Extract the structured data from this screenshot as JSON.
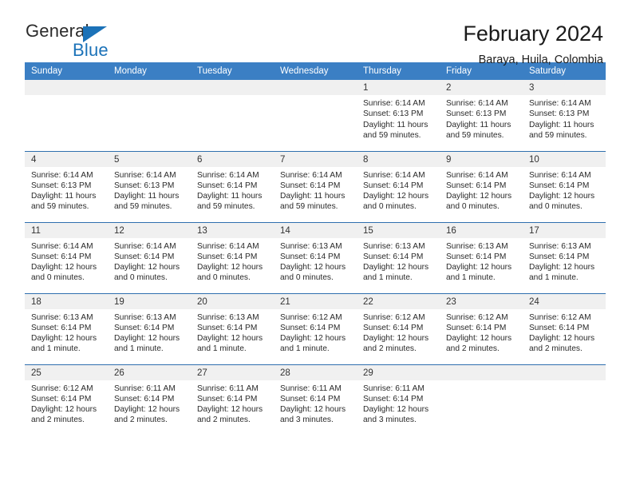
{
  "brand": {
    "name_part1": "General",
    "name_part2": "Blue",
    "accent_color": "#1b72b8"
  },
  "header": {
    "title": "February 2024",
    "subtitle": "Baraya, Huila, Colombia"
  },
  "calendar": {
    "header_bg": "#3b7fc4",
    "daynum_bg": "#f0f0f0",
    "row_border_color": "#2f6fae",
    "weekday_headers": [
      "Sunday",
      "Monday",
      "Tuesday",
      "Wednesday",
      "Thursday",
      "Friday",
      "Saturday"
    ],
    "weeks": [
      [
        {
          "day": "",
          "empty": true
        },
        {
          "day": "",
          "empty": true
        },
        {
          "day": "",
          "empty": true
        },
        {
          "day": "",
          "empty": true
        },
        {
          "day": "1",
          "sunrise": "Sunrise: 6:14 AM",
          "sunset": "Sunset: 6:13 PM",
          "daylight_1": "Daylight: 11 hours",
          "daylight_2": "and 59 minutes."
        },
        {
          "day": "2",
          "sunrise": "Sunrise: 6:14 AM",
          "sunset": "Sunset: 6:13 PM",
          "daylight_1": "Daylight: 11 hours",
          "daylight_2": "and 59 minutes."
        },
        {
          "day": "3",
          "sunrise": "Sunrise: 6:14 AM",
          "sunset": "Sunset: 6:13 PM",
          "daylight_1": "Daylight: 11 hours",
          "daylight_2": "and 59 minutes."
        }
      ],
      [
        {
          "day": "4",
          "sunrise": "Sunrise: 6:14 AM",
          "sunset": "Sunset: 6:13 PM",
          "daylight_1": "Daylight: 11 hours",
          "daylight_2": "and 59 minutes."
        },
        {
          "day": "5",
          "sunrise": "Sunrise: 6:14 AM",
          "sunset": "Sunset: 6:13 PM",
          "daylight_1": "Daylight: 11 hours",
          "daylight_2": "and 59 minutes."
        },
        {
          "day": "6",
          "sunrise": "Sunrise: 6:14 AM",
          "sunset": "Sunset: 6:14 PM",
          "daylight_1": "Daylight: 11 hours",
          "daylight_2": "and 59 minutes."
        },
        {
          "day": "7",
          "sunrise": "Sunrise: 6:14 AM",
          "sunset": "Sunset: 6:14 PM",
          "daylight_1": "Daylight: 11 hours",
          "daylight_2": "and 59 minutes."
        },
        {
          "day": "8",
          "sunrise": "Sunrise: 6:14 AM",
          "sunset": "Sunset: 6:14 PM",
          "daylight_1": "Daylight: 12 hours",
          "daylight_2": "and 0 minutes."
        },
        {
          "day": "9",
          "sunrise": "Sunrise: 6:14 AM",
          "sunset": "Sunset: 6:14 PM",
          "daylight_1": "Daylight: 12 hours",
          "daylight_2": "and 0 minutes."
        },
        {
          "day": "10",
          "sunrise": "Sunrise: 6:14 AM",
          "sunset": "Sunset: 6:14 PM",
          "daylight_1": "Daylight: 12 hours",
          "daylight_2": "and 0 minutes."
        }
      ],
      [
        {
          "day": "11",
          "sunrise": "Sunrise: 6:14 AM",
          "sunset": "Sunset: 6:14 PM",
          "daylight_1": "Daylight: 12 hours",
          "daylight_2": "and 0 minutes."
        },
        {
          "day": "12",
          "sunrise": "Sunrise: 6:14 AM",
          "sunset": "Sunset: 6:14 PM",
          "daylight_1": "Daylight: 12 hours",
          "daylight_2": "and 0 minutes."
        },
        {
          "day": "13",
          "sunrise": "Sunrise: 6:14 AM",
          "sunset": "Sunset: 6:14 PM",
          "daylight_1": "Daylight: 12 hours",
          "daylight_2": "and 0 minutes."
        },
        {
          "day": "14",
          "sunrise": "Sunrise: 6:13 AM",
          "sunset": "Sunset: 6:14 PM",
          "daylight_1": "Daylight: 12 hours",
          "daylight_2": "and 0 minutes."
        },
        {
          "day": "15",
          "sunrise": "Sunrise: 6:13 AM",
          "sunset": "Sunset: 6:14 PM",
          "daylight_1": "Daylight: 12 hours",
          "daylight_2": "and 1 minute."
        },
        {
          "day": "16",
          "sunrise": "Sunrise: 6:13 AM",
          "sunset": "Sunset: 6:14 PM",
          "daylight_1": "Daylight: 12 hours",
          "daylight_2": "and 1 minute."
        },
        {
          "day": "17",
          "sunrise": "Sunrise: 6:13 AM",
          "sunset": "Sunset: 6:14 PM",
          "daylight_1": "Daylight: 12 hours",
          "daylight_2": "and 1 minute."
        }
      ],
      [
        {
          "day": "18",
          "sunrise": "Sunrise: 6:13 AM",
          "sunset": "Sunset: 6:14 PM",
          "daylight_1": "Daylight: 12 hours",
          "daylight_2": "and 1 minute."
        },
        {
          "day": "19",
          "sunrise": "Sunrise: 6:13 AM",
          "sunset": "Sunset: 6:14 PM",
          "daylight_1": "Daylight: 12 hours",
          "daylight_2": "and 1 minute."
        },
        {
          "day": "20",
          "sunrise": "Sunrise: 6:13 AM",
          "sunset": "Sunset: 6:14 PM",
          "daylight_1": "Daylight: 12 hours",
          "daylight_2": "and 1 minute."
        },
        {
          "day": "21",
          "sunrise": "Sunrise: 6:12 AM",
          "sunset": "Sunset: 6:14 PM",
          "daylight_1": "Daylight: 12 hours",
          "daylight_2": "and 1 minute."
        },
        {
          "day": "22",
          "sunrise": "Sunrise: 6:12 AM",
          "sunset": "Sunset: 6:14 PM",
          "daylight_1": "Daylight: 12 hours",
          "daylight_2": "and 2 minutes."
        },
        {
          "day": "23",
          "sunrise": "Sunrise: 6:12 AM",
          "sunset": "Sunset: 6:14 PM",
          "daylight_1": "Daylight: 12 hours",
          "daylight_2": "and 2 minutes."
        },
        {
          "day": "24",
          "sunrise": "Sunrise: 6:12 AM",
          "sunset": "Sunset: 6:14 PM",
          "daylight_1": "Daylight: 12 hours",
          "daylight_2": "and 2 minutes."
        }
      ],
      [
        {
          "day": "25",
          "sunrise": "Sunrise: 6:12 AM",
          "sunset": "Sunset: 6:14 PM",
          "daylight_1": "Daylight: 12 hours",
          "daylight_2": "and 2 minutes."
        },
        {
          "day": "26",
          "sunrise": "Sunrise: 6:11 AM",
          "sunset": "Sunset: 6:14 PM",
          "daylight_1": "Daylight: 12 hours",
          "daylight_2": "and 2 minutes."
        },
        {
          "day": "27",
          "sunrise": "Sunrise: 6:11 AM",
          "sunset": "Sunset: 6:14 PM",
          "daylight_1": "Daylight: 12 hours",
          "daylight_2": "and 2 minutes."
        },
        {
          "day": "28",
          "sunrise": "Sunrise: 6:11 AM",
          "sunset": "Sunset: 6:14 PM",
          "daylight_1": "Daylight: 12 hours",
          "daylight_2": "and 3 minutes."
        },
        {
          "day": "29",
          "sunrise": "Sunrise: 6:11 AM",
          "sunset": "Sunset: 6:14 PM",
          "daylight_1": "Daylight: 12 hours",
          "daylight_2": "and 3 minutes."
        },
        {
          "day": "",
          "empty": true
        },
        {
          "day": "",
          "empty": true
        }
      ]
    ]
  }
}
